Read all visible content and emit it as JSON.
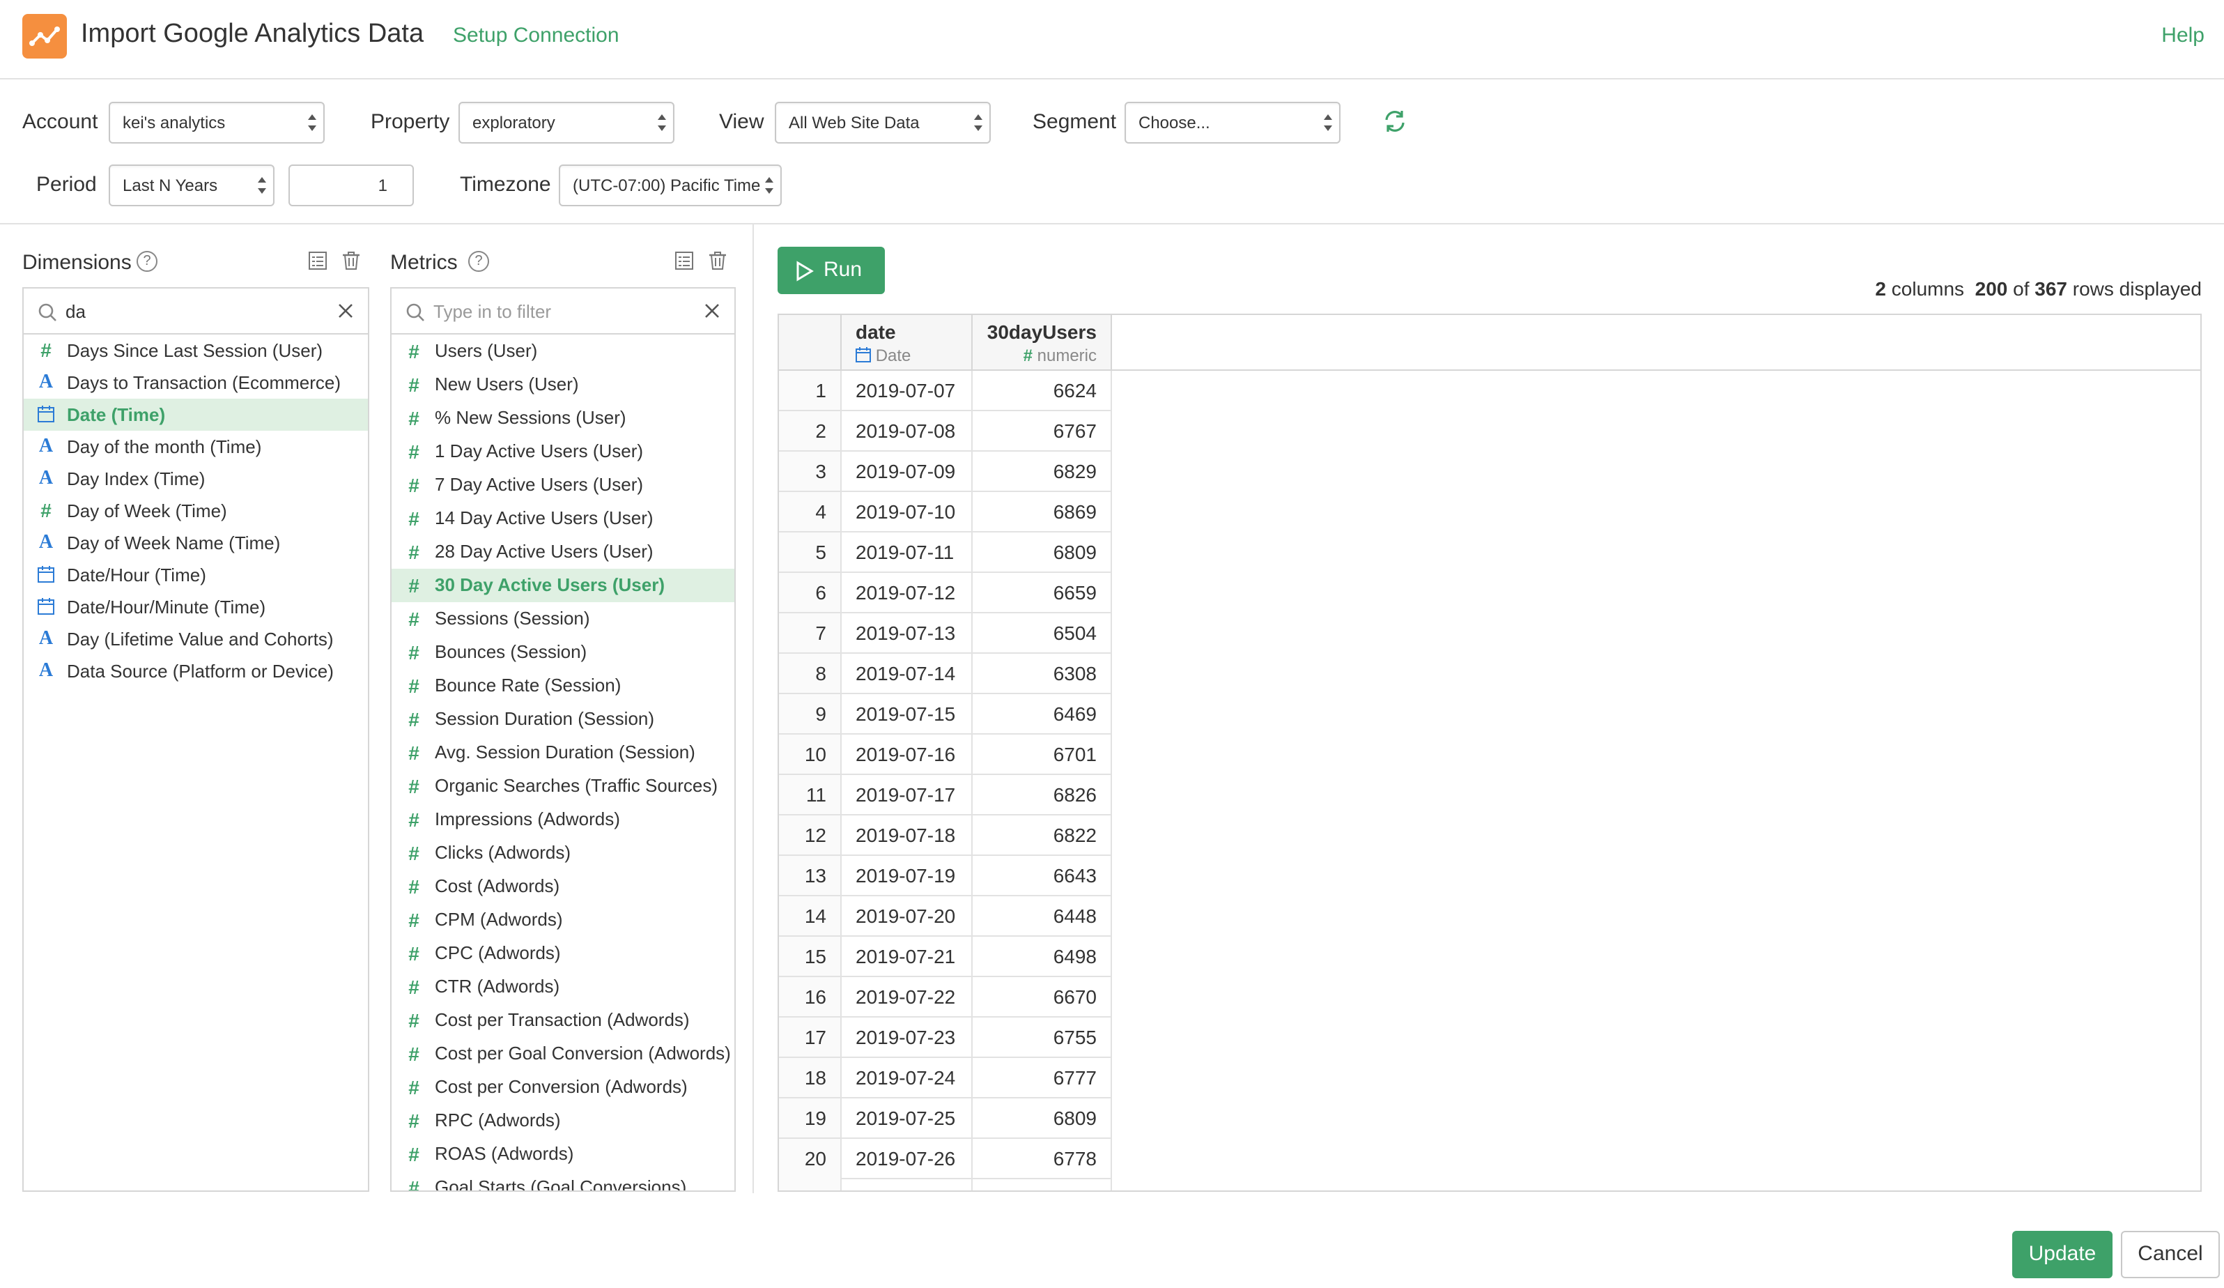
{
  "header": {
    "title": "Import Google Analytics Data",
    "setup_link": "Setup Connection",
    "help_link": "Help",
    "logo_icon": "chart-line-icon",
    "logo_color": "#f58f3f"
  },
  "form": {
    "account": {
      "label": "Account",
      "value": "kei's analytics"
    },
    "property": {
      "label": "Property",
      "value": "exploratory"
    },
    "view": {
      "label": "View",
      "value": "All Web Site Data"
    },
    "segment": {
      "label": "Segment",
      "value": "Choose..."
    },
    "period": {
      "label": "Period",
      "value": "Last N Years",
      "count": "1"
    },
    "timezone": {
      "label": "Timezone",
      "value": "(UTC-07:00) Pacific Time"
    }
  },
  "dimensions": {
    "title": "Dimensions",
    "filter_value": "da",
    "items": [
      {
        "label": "Days Since Last Session (User)",
        "type": "number"
      },
      {
        "label": "Days to Transaction (Ecommerce)",
        "type": "string"
      },
      {
        "label": "Date (Time)",
        "type": "date",
        "selected": true
      },
      {
        "label": "Day of the month (Time)",
        "type": "string"
      },
      {
        "label": "Day Index (Time)",
        "type": "string"
      },
      {
        "label": "Day of Week (Time)",
        "type": "number"
      },
      {
        "label": "Day of Week Name (Time)",
        "type": "string"
      },
      {
        "label": "Date/Hour (Time)",
        "type": "date"
      },
      {
        "label": "Date/Hour/Minute (Time)",
        "type": "date"
      },
      {
        "label": "Day (Lifetime Value and Cohorts)",
        "type": "string"
      },
      {
        "label": "Data Source (Platform or Device)",
        "type": "string"
      }
    ]
  },
  "metrics": {
    "title": "Metrics",
    "filter_placeholder": "Type in to filter",
    "items": [
      {
        "label": "Users (User)"
      },
      {
        "label": "New Users (User)"
      },
      {
        "label": "% New Sessions (User)"
      },
      {
        "label": "1 Day Active Users (User)"
      },
      {
        "label": "7 Day Active Users (User)"
      },
      {
        "label": "14 Day Active Users (User)"
      },
      {
        "label": "28 Day Active Users (User)"
      },
      {
        "label": "30 Day Active Users (User)",
        "selected": true
      },
      {
        "label": "Sessions (Session)"
      },
      {
        "label": "Bounces (Session)"
      },
      {
        "label": "Bounce Rate (Session)"
      },
      {
        "label": "Session Duration (Session)"
      },
      {
        "label": "Avg. Session Duration (Session)"
      },
      {
        "label": "Organic Searches (Traffic Sources)"
      },
      {
        "label": "Impressions (Adwords)"
      },
      {
        "label": "Clicks (Adwords)"
      },
      {
        "label": "Cost (Adwords)"
      },
      {
        "label": "CPM (Adwords)"
      },
      {
        "label": "CPC (Adwords)"
      },
      {
        "label": "CTR (Adwords)"
      },
      {
        "label": "Cost per Transaction (Adwords)"
      },
      {
        "label": "Cost per Goal Conversion (Adwords)"
      },
      {
        "label": "Cost per Conversion (Adwords)"
      },
      {
        "label": "RPC (Adwords)"
      },
      {
        "label": "ROAS (Adwords)"
      },
      {
        "label": "Goal Starts (Goal Conversions)"
      }
    ]
  },
  "results": {
    "run_label": "Run",
    "summary": {
      "columns": "2",
      "columns_word": "columns",
      "displayed": "200",
      "of_word": "of",
      "total": "367",
      "rows_word": "rows displayed"
    },
    "columns": [
      {
        "name": "date",
        "type": "Date"
      },
      {
        "name": "30dayUsers",
        "type": "numeric"
      }
    ],
    "rows": [
      {
        "n": "1",
        "date": "2019-07-07",
        "value": "6624"
      },
      {
        "n": "2",
        "date": "2019-07-08",
        "value": "6767"
      },
      {
        "n": "3",
        "date": "2019-07-09",
        "value": "6829"
      },
      {
        "n": "4",
        "date": "2019-07-10",
        "value": "6869"
      },
      {
        "n": "5",
        "date": "2019-07-11",
        "value": "6809"
      },
      {
        "n": "6",
        "date": "2019-07-12",
        "value": "6659"
      },
      {
        "n": "7",
        "date": "2019-07-13",
        "value": "6504"
      },
      {
        "n": "8",
        "date": "2019-07-14",
        "value": "6308"
      },
      {
        "n": "9",
        "date": "2019-07-15",
        "value": "6469"
      },
      {
        "n": "10",
        "date": "2019-07-16",
        "value": "6701"
      },
      {
        "n": "11",
        "date": "2019-07-17",
        "value": "6826"
      },
      {
        "n": "12",
        "date": "2019-07-18",
        "value": "6822"
      },
      {
        "n": "13",
        "date": "2019-07-19",
        "value": "6643"
      },
      {
        "n": "14",
        "date": "2019-07-20",
        "value": "6448"
      },
      {
        "n": "15",
        "date": "2019-07-21",
        "value": "6498"
      },
      {
        "n": "16",
        "date": "2019-07-22",
        "value": "6670"
      },
      {
        "n": "17",
        "date": "2019-07-23",
        "value": "6755"
      },
      {
        "n": "18",
        "date": "2019-07-24",
        "value": "6777"
      },
      {
        "n": "19",
        "date": "2019-07-25",
        "value": "6809"
      },
      {
        "n": "20",
        "date": "2019-07-26",
        "value": "6778"
      }
    ]
  },
  "footer": {
    "update_label": "Update",
    "cancel_label": "Cancel"
  },
  "colors": {
    "accent": "#3ea169",
    "string_type": "#2b7bd6",
    "selected_row": "#dff0e2"
  }
}
